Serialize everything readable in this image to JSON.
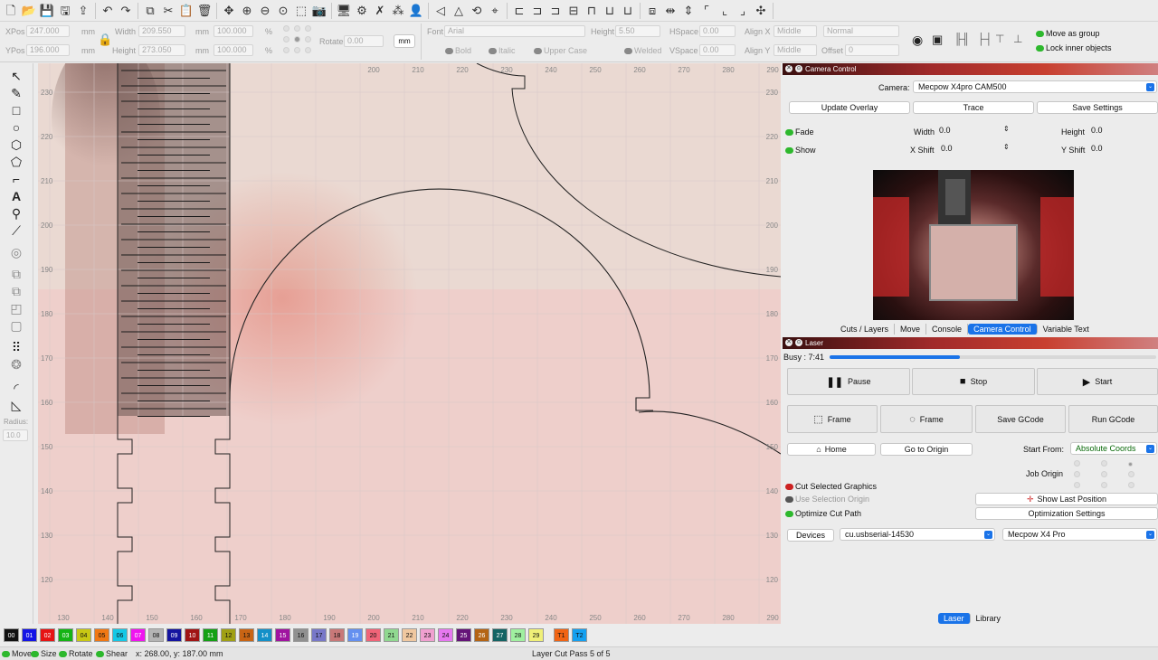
{
  "toolbar": {
    "icons": [
      "new-file-icon",
      "open-file-icon",
      "save-icon",
      "save-as-icon",
      "import-icon",
      "undo-icon",
      "redo-icon",
      "copy-icon",
      "cut-icon",
      "paste-icon",
      "delete-icon",
      "move-icon",
      "zoom-in-icon",
      "zoom-out-icon",
      "zoom-fit-icon",
      "zoom-frame-icon",
      "camera-icon",
      "monitor-icon",
      "settings-icon",
      "tools-icon",
      "group-icon",
      "user-icon",
      "mirror-h-icon",
      "mirror-v-icon",
      "rotate-icon",
      "target-icon",
      "align-left-icon",
      "align-center-icon",
      "align-right-icon",
      "distribute-icon",
      "align-top-icon",
      "align-middle-icon",
      "align-bottom-icon",
      "arrange-icon",
      "distribute-h-icon",
      "distribute-v-icon",
      "dock-icon",
      "move-lb-icon",
      "move-rb-icon",
      "move-center-icon"
    ]
  },
  "props": {
    "xpos_label": "XPos",
    "xpos_value": "247.000",
    "ypos_label": "YPos",
    "ypos_value": "196.000",
    "mm1": "mm",
    "mm2": "mm",
    "width_label": "Width",
    "width_value": "209.550",
    "height_label": "Height",
    "height_value": "273.050",
    "mm3": "mm",
    "mm4": "mm",
    "pct_w": "100.000",
    "pct_h": "100.000",
    "pct1": "%",
    "pct2": "%",
    "rotate_label": "Rotate",
    "rotate_value": "0.00",
    "unit_button": "mm",
    "font_label": "Font",
    "font_value": "Arial",
    "text_height_label": "Height",
    "text_height_value": "5.50",
    "hspace_label": "HSpace",
    "hspace_value": "0.00",
    "vspace_label": "VSpace",
    "vspace_value": "0.00",
    "alignx_label": "Align X",
    "alignx_value": "Middle",
    "aligny_label": "Align Y",
    "aligny_value": "Middle",
    "normal_value": "Normal",
    "offset_label": "Offset",
    "offset_value": "0",
    "bold_label": "Bold",
    "italic_label": "Italic",
    "upper_label": "Upper Case",
    "welded_label": "Welded",
    "move_as_group": "Move as group",
    "lock_inner": "Lock inner objects"
  },
  "left_tools": {
    "radius_label": "Radius:",
    "radius_value": "10.0"
  },
  "canvas": {
    "top_ruler": [
      "200",
      "210",
      "220",
      "230",
      "240",
      "250",
      "260",
      "270",
      "280",
      "290"
    ],
    "bottom_ruler": [
      "130",
      "140",
      "150",
      "160",
      "170",
      "180",
      "190",
      "200",
      "210",
      "220",
      "230",
      "240",
      "250",
      "260",
      "270",
      "280",
      "290"
    ],
    "left_ruler": [
      "230",
      "220",
      "210",
      "200",
      "190",
      "180",
      "170",
      "160",
      "150",
      "140",
      "130",
      "120"
    ],
    "right_ruler": [
      "230",
      "220",
      "210",
      "200",
      "190",
      "180",
      "170",
      "160",
      "150",
      "140",
      "130",
      "120"
    ]
  },
  "camera_panel": {
    "title": "Camera Control",
    "camera_label": "Camera:",
    "camera_value": "Mecpow X4pro CAM500",
    "update_overlay": "Update Overlay",
    "trace": "Trace",
    "save_settings": "Save Settings",
    "fade_label": "Fade",
    "show_label": "Show",
    "width_label": "Width",
    "width_value": "0.0",
    "height_label": "Height",
    "height_value": "0.0",
    "xshift_label": "X Shift",
    "xshift_value": "0.0",
    "yshift_label": "Y Shift",
    "yshift_value": "0.0",
    "tabs": [
      "Cuts / Layers",
      "Move",
      "Console",
      "Camera Control",
      "Variable Text"
    ],
    "active_tab": "Camera Control"
  },
  "laser_panel": {
    "title": "Laser",
    "busy": "Busy : 7:41",
    "progress": 0.4,
    "pause": "Pause",
    "stop": "Stop",
    "start": "Start",
    "frame1": "Frame",
    "frame2": "Frame",
    "save_gcode": "Save GCode",
    "run_gcode": "Run GCode",
    "home": "Home",
    "go_to_origin": "Go to Origin",
    "start_from_label": "Start From:",
    "start_from_value": "Absolute Coords",
    "job_origin_label": "Job Origin",
    "cut_selected": "Cut Selected Graphics",
    "use_selection_origin": "Use Selection Origin",
    "optimize_cut_path": "Optimize Cut Path",
    "show_last_position": "Show Last Position",
    "optimization_settings": "Optimization Settings",
    "devices": "Devices",
    "port_value": "cu.usbserial-14530",
    "device_value": "Mecpow X4 Pro",
    "bottom_tabs": [
      "Laser",
      "Library"
    ],
    "active_bottom_tab": "Laser"
  },
  "palette": [
    {
      "label": "00",
      "color": "#111111",
      "text": "#ffffff"
    },
    {
      "label": "01",
      "color": "#1414e6",
      "text": "#ffffff"
    },
    {
      "label": "02",
      "color": "#e61414",
      "text": "#ffffff"
    },
    {
      "label": "03",
      "color": "#14b414",
      "text": "#ffffff"
    },
    {
      "label": "04",
      "color": "#c8c814",
      "text": "#111111"
    },
    {
      "label": "05",
      "color": "#f07814",
      "text": "#111111"
    },
    {
      "label": "06",
      "color": "#14c8e6",
      "text": "#111111"
    },
    {
      "label": "07",
      "color": "#f014f0",
      "text": "#ffffff"
    },
    {
      "label": "08",
      "color": "#b4b4b4",
      "text": "#111111"
    },
    {
      "label": "09",
      "color": "#1414a0",
      "text": "#ffffff"
    },
    {
      "label": "10",
      "color": "#a01414",
      "text": "#ffffff"
    },
    {
      "label": "11",
      "color": "#14a014",
      "text": "#ffffff"
    },
    {
      "label": "12",
      "color": "#a0a014",
      "text": "#111111"
    },
    {
      "label": "13",
      "color": "#c86414",
      "text": "#111111"
    },
    {
      "label": "14",
      "color": "#1490c8",
      "text": "#ffffff"
    },
    {
      "label": "15",
      "color": "#a014a0",
      "text": "#ffffff"
    },
    {
      "label": "16",
      "color": "#909090",
      "text": "#111111"
    },
    {
      "label": "17",
      "color": "#7878c8",
      "text": "#111111"
    },
    {
      "label": "18",
      "color": "#c87878",
      "text": "#111111"
    },
    {
      "label": "19",
      "color": "#6490f0",
      "text": "#ffffff"
    },
    {
      "label": "20",
      "color": "#f06478",
      "text": "#111111"
    },
    {
      "label": "21",
      "color": "#90d890",
      "text": "#111111"
    },
    {
      "label": "22",
      "color": "#f0c8a0",
      "text": "#111111"
    },
    {
      "label": "23",
      "color": "#f0a0d0",
      "text": "#111111"
    },
    {
      "label": "24",
      "color": "#e678f0",
      "text": "#111111"
    },
    {
      "label": "25",
      "color": "#641478",
      "text": "#ffffff"
    },
    {
      "label": "26",
      "color": "#b46414",
      "text": "#ffffff"
    },
    {
      "label": "27",
      "color": "#146464",
      "text": "#ffffff"
    },
    {
      "label": "28",
      "color": "#a0f0a0",
      "text": "#111111"
    },
    {
      "label": "29",
      "color": "#f0f078",
      "text": "#111111"
    },
    {
      "label": "T1",
      "color": "#f06414",
      "text": "#111111"
    },
    {
      "label": "T2",
      "color": "#14a0f0",
      "text": "#111111"
    }
  ],
  "status": {
    "move": "Move",
    "size": "Size",
    "rotate": "Rotate",
    "shear": "Shear",
    "coords": "x: 268.00, y: 187.00 mm",
    "pass": "Layer Cut Pass 5 of 5"
  }
}
